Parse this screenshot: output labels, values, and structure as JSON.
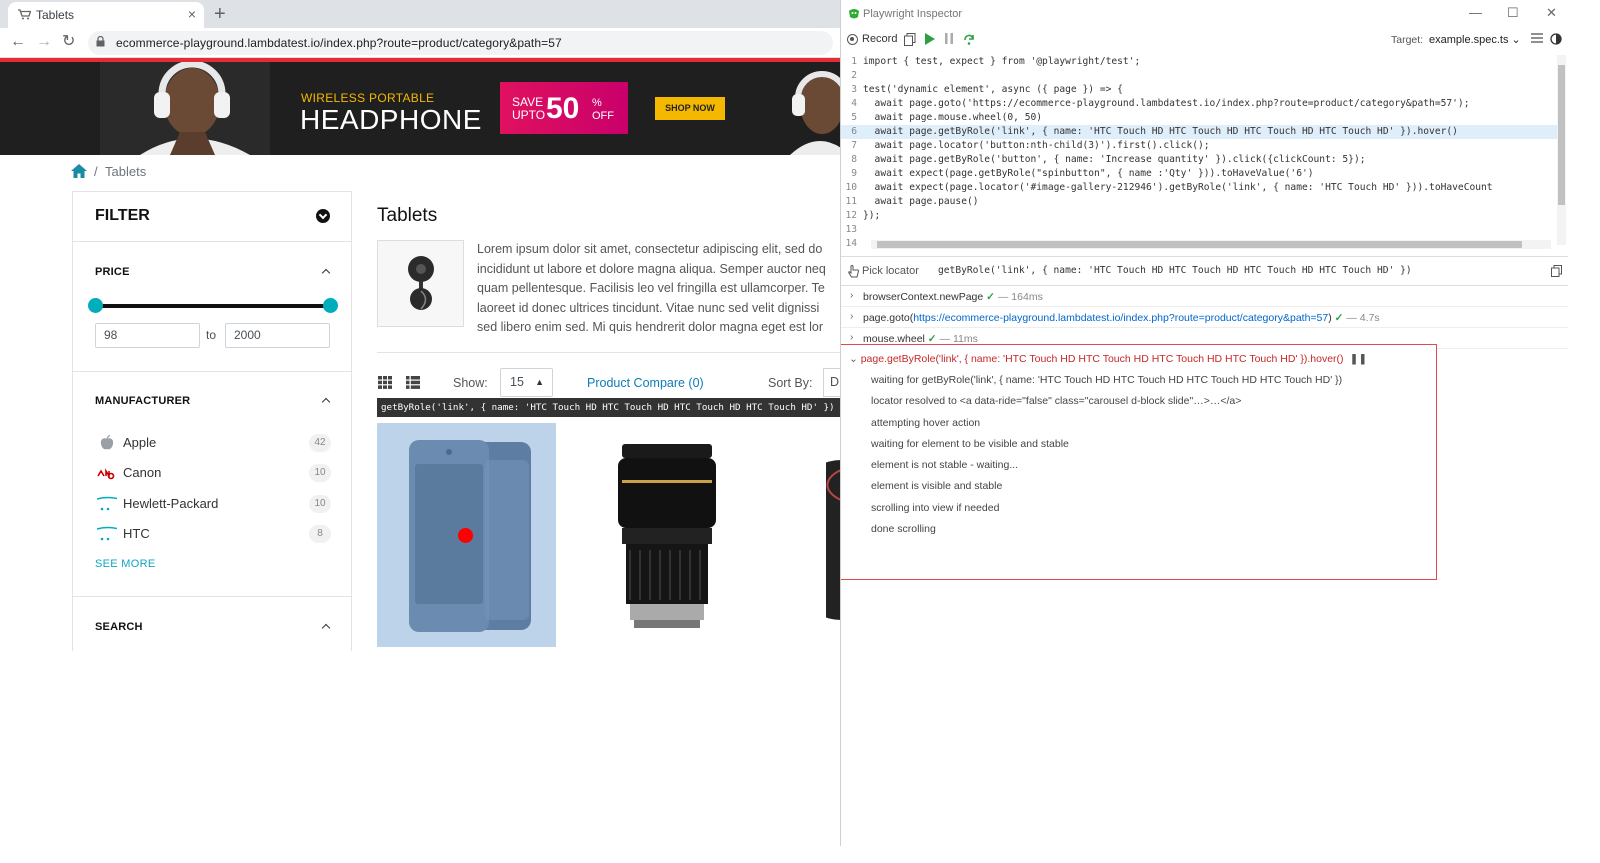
{
  "browser": {
    "tab_title": "Tablets",
    "tab_close": "×",
    "new_tab": "+",
    "back": "←",
    "forward": "→",
    "reload": "↻",
    "url": "ecommerce-playground.lambdatest.io/index.php?route=product/category&path=57"
  },
  "banner": {
    "kicker": "WIRELESS PORTABLE",
    "headline": "HEADPHONE",
    "save_line1": "SAVE",
    "save_line2": "UPTO",
    "save_value": "50",
    "save_pct": "%",
    "save_off": "OFF",
    "cta": "SHOP NOW"
  },
  "breadcrumb": {
    "separator": "/",
    "current": "Tablets"
  },
  "filter": {
    "title": "FILTER",
    "price": {
      "label": "PRICE",
      "min": "98",
      "to": "to",
      "max": "2000"
    },
    "manufacturer": {
      "label": "MANUFACTURER",
      "items": [
        {
          "name": "Apple",
          "count": "42",
          "logo": "apple-icon"
        },
        {
          "name": "Canon",
          "count": "10",
          "logo": "canon-logo"
        },
        {
          "name": "Hewlett-Packard",
          "count": "10",
          "logo": "hp-logo"
        },
        {
          "name": "HTC",
          "count": "8",
          "logo": "htc-logo"
        }
      ],
      "see_more": "SEE MORE"
    },
    "search": {
      "label": "SEARCH"
    }
  },
  "category": {
    "title": "Tablets",
    "description": [
      "Lorem ipsum dolor sit amet, consectetur adipiscing elit, sed do",
      "incididunt ut labore et dolore magna aliqua. Semper auctor neq",
      "quam pellentesque. Facilisis leo vel fringilla est ullamcorper. Te",
      "laoreet id donec ultrices tincidunt. Vitae nunc sed velit dignissi",
      "sed libero enim sed. Mi quis hendrerit dolor magna eget est lor"
    ],
    "show_label": "Show:",
    "show_value": "15",
    "compare": "Product Compare (0)",
    "sort_label": "Sort By:",
    "sort_value": "D"
  },
  "tooltip": "getByRole('link', { name: 'HTC Touch HD HTC Touch HD HTC Touch HD HTC Touch HD' })",
  "inspector": {
    "title": "Playwright Inspector",
    "win_min": "—",
    "win_max": "☐",
    "win_close": "✕",
    "record_label": "Record",
    "target_label": "Target:",
    "target_value": "example.spec.ts ⌄",
    "code_lines": [
      {
        "n": "1",
        "t": "import { test, expect } from '@playwright/test';"
      },
      {
        "n": "2",
        "t": ""
      },
      {
        "n": "3",
        "t": "test('dynamic element', async ({ page }) => {"
      },
      {
        "n": "4",
        "t": "  await page.goto('https://ecommerce-playground.lambdatest.io/index.php?route=product/category&path=57');"
      },
      {
        "n": "5",
        "t": "  await page.mouse.wheel(0, 50)"
      },
      {
        "n": "6",
        "t": "  await page.getByRole('link', { name: 'HTC Touch HD HTC Touch HD HTC Touch HD HTC Touch HD' }).hover()"
      },
      {
        "n": "7",
        "t": "  await page.locator('button:nth-child(3)').first().click();"
      },
      {
        "n": "8",
        "t": "  await page.getByRole('button', { name: 'Increase quantity' }).click({clickCount: 5});"
      },
      {
        "n": "9",
        "t": "  await expect(page.getByRole(\"spinbutton\", { name :'Qty' })).toHaveValue('6')"
      },
      {
        "n": "10",
        "t": "  await expect(page.locator('#image-gallery-212946').getByRole('link', { name: 'HTC Touch HD' })).toHaveCount"
      },
      {
        "n": "11",
        "t": "  await page.pause()"
      },
      {
        "n": "12",
        "t": "});"
      },
      {
        "n": "13",
        "t": ""
      },
      {
        "n": "14",
        "t": ""
      }
    ],
    "pick_label": "Pick locator",
    "pick_value": "getByRole('link', { name: 'HTC Touch HD HTC Touch HD HTC Touch HD HTC Touch HD' })",
    "log": [
      {
        "action": "browserContext.newPage",
        "link": "",
        "suffix": "",
        "ok": "✓",
        "duration": "— 164ms"
      },
      {
        "action": "page.goto(",
        "link": "https://ecommerce-playground.lambdatest.io/index.php?route=product/category&path=57",
        "suffix": ")",
        "ok": "✓",
        "duration": "— 4.7s"
      },
      {
        "action": "mouse.wheel",
        "link": "",
        "suffix": "",
        "ok": "✓",
        "duration": "— 11ms"
      }
    ],
    "active": {
      "head": "page.getByRole('link', { name: 'HTC Touch HD HTC Touch HD HTC Touch HD HTC Touch HD' }).hover()",
      "pause": "❚❚",
      "lines": [
        "waiting for getByRole('link', { name: 'HTC Touch HD HTC Touch HD HTC Touch HD HTC Touch HD' })",
        "locator resolved to <a data-ride=\"false\" class=\"carousel d-block slide\"…>…</a>",
        "attempting hover action",
        "waiting for element to be visible and stable",
        "element is not stable - waiting...",
        "element is visible and stable",
        "scrolling into view if needed",
        "done scrolling"
      ]
    }
  },
  "colors": {
    "accent": "#00aebb",
    "link": "#0e7bb5",
    "banner_pink": "#e0115f",
    "banner_yellow": "#f5b800",
    "log_error": "#e3474f"
  }
}
